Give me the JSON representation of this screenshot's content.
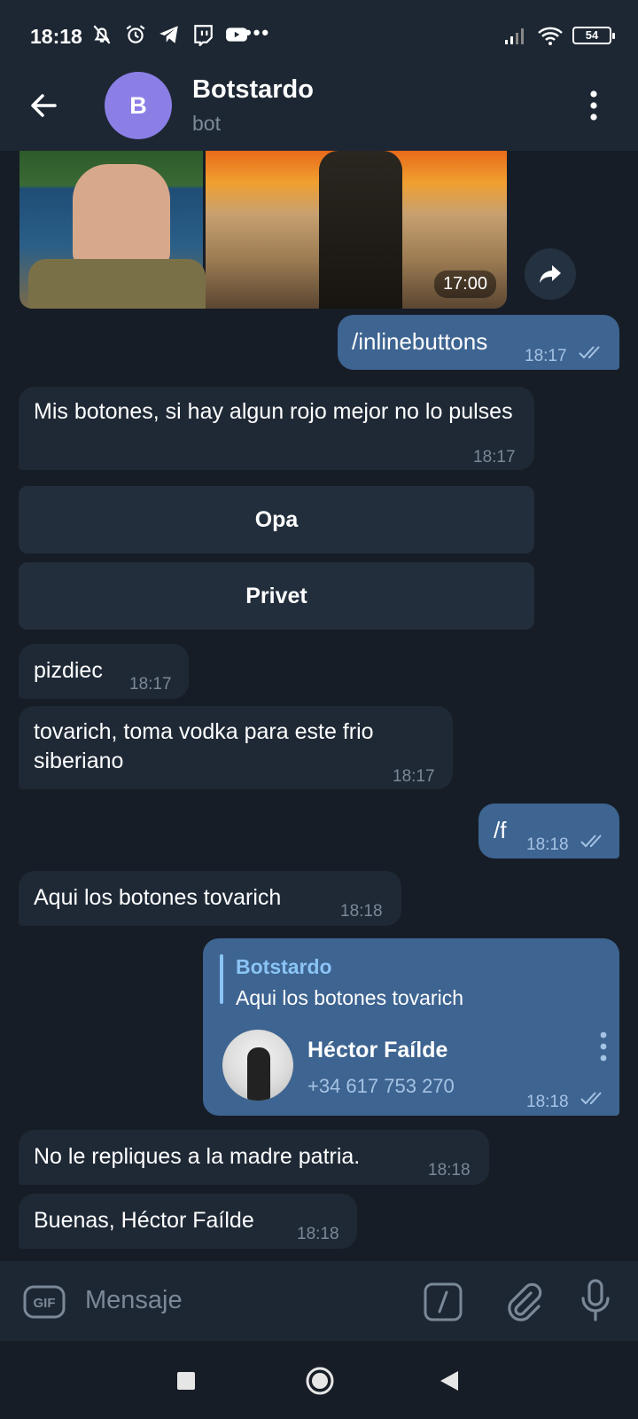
{
  "status_bar": {
    "time": "18:18",
    "battery": "54"
  },
  "header": {
    "avatar_letter": "B",
    "title": "Botstardo",
    "subtitle": "bot"
  },
  "photo_message": {
    "time": "17:00"
  },
  "messages": [
    {
      "direction": "out",
      "text": "/inlinebuttons",
      "time": "18:17"
    },
    {
      "direction": "in",
      "text": "Mis botones, si hay algun rojo mejor no lo pulses",
      "time": "18:17"
    },
    {
      "direction": "in",
      "text": "pizdiec",
      "time": "18:17"
    },
    {
      "direction": "in",
      "text": "tovarich, toma vodka para este frio siberiano",
      "time": "18:17"
    },
    {
      "direction": "out",
      "text": "/f",
      "time": "18:18"
    },
    {
      "direction": "in",
      "text": "Aqui los botones tovarich",
      "time": "18:18"
    },
    {
      "direction": "out",
      "reply_to_name": "Botstardo",
      "reply_to_text": "Aqui los botones tovarich",
      "contact_name": "Héctor Faílde",
      "contact_phone": "+34 617 753 270",
      "time": "18:18"
    },
    {
      "direction": "in",
      "text": "No le repliques a la madre patria.",
      "time": "18:18"
    },
    {
      "direction": "in",
      "text": "Buenas, Héctor Faílde",
      "time": "18:18"
    }
  ],
  "inline_buttons": [
    "Opa",
    "Privet"
  ],
  "input": {
    "placeholder": "Mensaje"
  },
  "colors": {
    "background": "#161d26",
    "header": "#1d2733",
    "incoming": "#1f2936",
    "outgoing": "#3e6491",
    "accent": "#8ac4f5"
  }
}
